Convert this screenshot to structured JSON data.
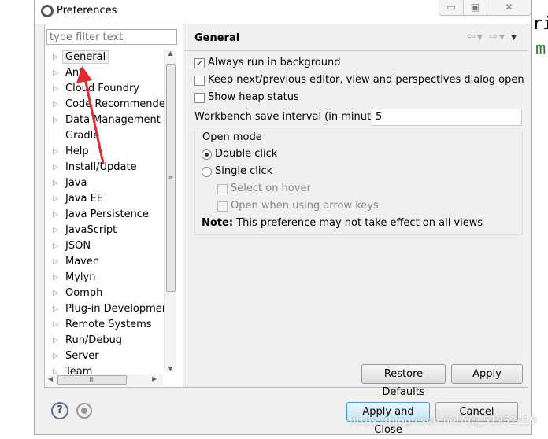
{
  "window": {
    "title": "Preferences",
    "buttons": [
      "minimize",
      "maximize",
      "close"
    ]
  },
  "background_code": {
    "line1": "ri",
    "line2": "m"
  },
  "filter": {
    "placeholder": "type filter text"
  },
  "tree": [
    {
      "label": "General",
      "expandable": true,
      "selected": true
    },
    {
      "label": "Ant",
      "expandable": true
    },
    {
      "label": "Cloud Foundry",
      "expandable": true
    },
    {
      "label": "Code Recommenders",
      "expandable": true
    },
    {
      "label": "Data Management",
      "expandable": true
    },
    {
      "label": "Gradle",
      "expandable": false
    },
    {
      "label": "Help",
      "expandable": true
    },
    {
      "label": "Install/Update",
      "expandable": true
    },
    {
      "label": "Java",
      "expandable": true
    },
    {
      "label": "Java EE",
      "expandable": true
    },
    {
      "label": "Java Persistence",
      "expandable": true
    },
    {
      "label": "JavaScript",
      "expandable": true
    },
    {
      "label": "JSON",
      "expandable": true
    },
    {
      "label": "Maven",
      "expandable": true
    },
    {
      "label": "Mylyn",
      "expandable": true
    },
    {
      "label": "Oomph",
      "expandable": true
    },
    {
      "label": "Plug-in Development",
      "expandable": true
    },
    {
      "label": "Remote Systems",
      "expandable": true
    },
    {
      "label": "Run/Debug",
      "expandable": true
    },
    {
      "label": "Server",
      "expandable": true
    },
    {
      "label": "Team",
      "expandable": true
    }
  ],
  "page": {
    "title": "General",
    "always_run": {
      "label": "Always run in background",
      "checked": true
    },
    "keep_next": {
      "label": "Keep next/previous editor, view and perspectives dialog open",
      "checked": false
    },
    "heap": {
      "label": "Show heap status",
      "checked": false
    },
    "save_interval": {
      "label": "Workbench save interval (in minutes):",
      "value": "5"
    },
    "open_mode": {
      "label": "Open mode",
      "double_click": {
        "label": "Double click",
        "selected": true
      },
      "single_click": {
        "label": "Single click",
        "selected": false
      },
      "select_hover": {
        "label": "Select on hover",
        "checked": false,
        "enabled": false
      },
      "arrow_keys": {
        "label": "Open when using arrow keys",
        "checked": false,
        "enabled": false
      },
      "note_bold": "Note:",
      "note": "This preference may not take effect on all views"
    },
    "restore_defaults": "Restore Defaults",
    "apply": "Apply"
  },
  "footer": {
    "apply_close": "Apply and Close",
    "cancel": "Cancel"
  },
  "watermark": "https://blog.csdn.net/qq_51952119",
  "annotation_color": "#e8262c"
}
